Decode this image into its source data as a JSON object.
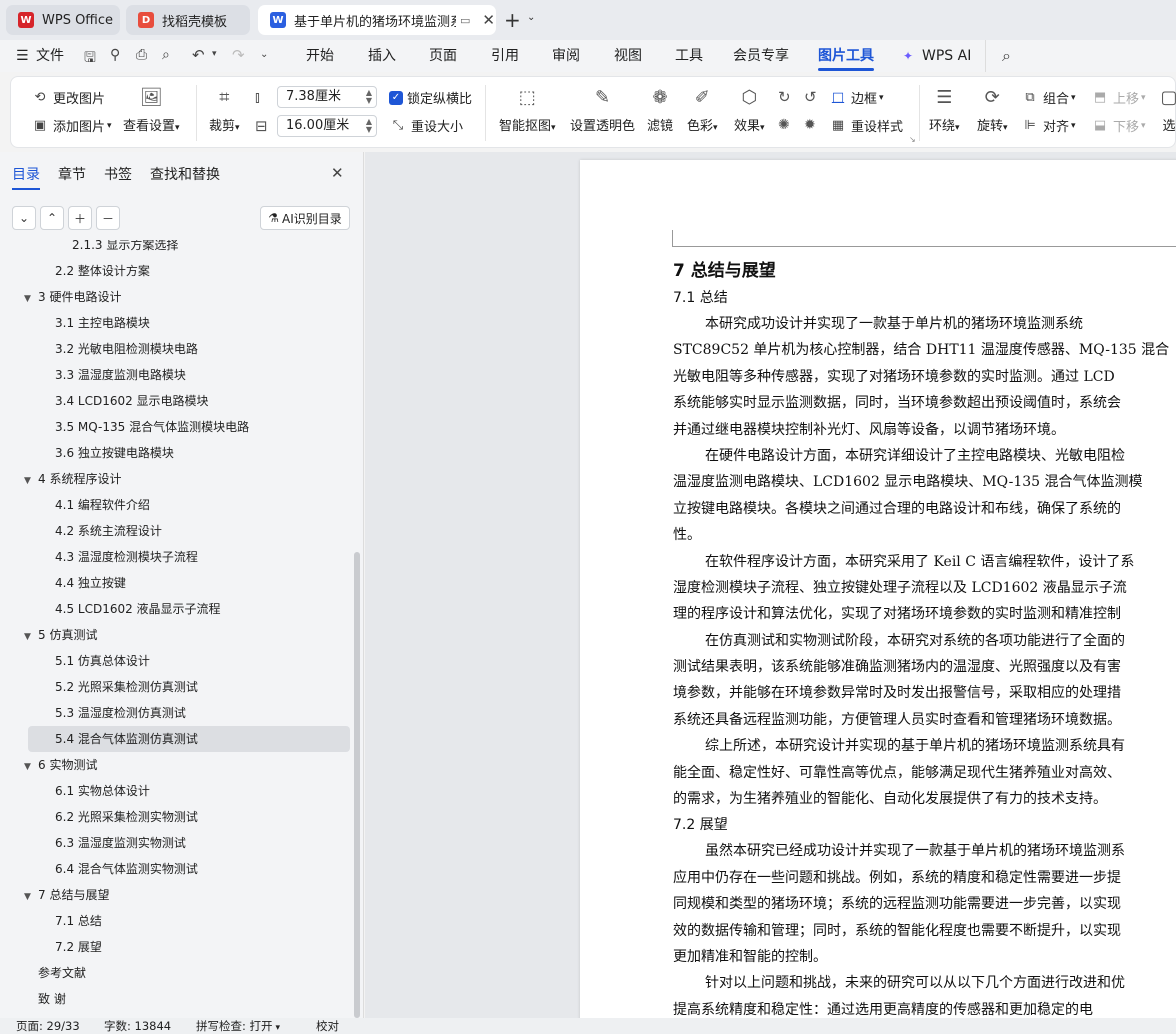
{
  "tabs": [
    {
      "label": "WPS Office",
      "icon": "wps-logo-icon",
      "color": "#d6242a"
    },
    {
      "label": "找稻壳模板",
      "icon": "docer-icon",
      "color": "#e84d3d"
    },
    {
      "label": "基于单片机的猪场环境监测系",
      "icon": "word-doc-icon",
      "color": "#2b5fe0"
    }
  ],
  "menu": {
    "file": "文件",
    "items": [
      "开始",
      "插入",
      "页面",
      "引用",
      "审阅",
      "视图",
      "工具",
      "会员专享",
      "图片工具",
      "WPS AI"
    ],
    "active": "图片工具"
  },
  "ribbon": {
    "change_image": "更改图片",
    "add_image": "添加图片",
    "view_settings": "查看设置",
    "crop": "裁剪",
    "width": "7.38厘米",
    "height": "16.00厘米",
    "lock_ratio": "锁定纵横比",
    "reset_size": "重设大小",
    "smart_cutout": "智能抠图",
    "set_transparent": "设置透明色",
    "filter": "滤镜",
    "color": "色彩",
    "effect": "效果",
    "border": "边框",
    "reset_style": "重设样式",
    "wrap": "环绕",
    "rotate": "旋转",
    "group": "组合",
    "align": "对齐",
    "bring_forward": "上移",
    "send_backward": "下移",
    "select": "选"
  },
  "sidebar": {
    "tabs": [
      "目录",
      "章节",
      "书签",
      "查找和替换"
    ],
    "ai_button": "AI识别目录",
    "toc": [
      {
        "label": "2.1.3  显示方案选择",
        "level": 3
      },
      {
        "label": "2.2  整体设计方案",
        "level": 2
      },
      {
        "label": "3    硬件电路设计",
        "level": 1,
        "expanded": true
      },
      {
        "label": "3.1  主控电路模块",
        "level": 2
      },
      {
        "label": "3.2  光敏电阻检测模块电路",
        "level": 2
      },
      {
        "label": "3.3  温湿度监测电路模块",
        "level": 2
      },
      {
        "label": "3.4 LCD1602 显示电路模块",
        "level": 2
      },
      {
        "label": "3.5 MQ-135 混合气体监测模块电路",
        "level": 2
      },
      {
        "label": "3.6  独立按键电路模块",
        "level": 2
      },
      {
        "label": "4    系统程序设计",
        "level": 1,
        "expanded": true
      },
      {
        "label": "4.1  编程软件介绍",
        "level": 2
      },
      {
        "label": "4.2  系统主流程设计",
        "level": 2
      },
      {
        "label": "4.3  温湿度检测模块子流程",
        "level": 2
      },
      {
        "label": "4.4  独立按键",
        "level": 2
      },
      {
        "label": "4.5 LCD1602 液晶显示子流程",
        "level": 2
      },
      {
        "label": "5    仿真测试",
        "level": 1,
        "expanded": true
      },
      {
        "label": "5.1  仿真总体设计",
        "level": 2
      },
      {
        "label": "5.2  光照采集检测仿真测试",
        "level": 2
      },
      {
        "label": "5.3  温湿度检测仿真测试",
        "level": 2
      },
      {
        "label": "5.4  混合气体监测仿真测试",
        "level": 2,
        "selected": true
      },
      {
        "label": "6    实物测试",
        "level": 1,
        "expanded": true
      },
      {
        "label": "6.1  实物总体设计",
        "level": 2
      },
      {
        "label": "6.2  光照采集检测实物测试",
        "level": 2
      },
      {
        "label": "6.3  温湿度监测实物测试",
        "level": 2
      },
      {
        "label": "6.4  混合气体监测实物测试",
        "level": 2
      },
      {
        "label": "7    总结与展望",
        "level": 1,
        "expanded": true
      },
      {
        "label": "7.1  总结",
        "level": 2
      },
      {
        "label": "7.2  展望",
        "level": 2
      },
      {
        "label": "参考文献",
        "level": 1
      },
      {
        "label": "致    谢",
        "level": 1
      }
    ]
  },
  "document": {
    "chapter": "7    总结与展望",
    "s1": "7.1  总结",
    "p1": [
      "本研究成功设计并实现了一款基于单片机的猪场环境监测系统",
      "STC89C52 单片机为核心控制器，结合 DHT11 温湿度传感器、MQ-135 混合",
      "光敏电阻等多种传感器，实现了对猪场环境参数的实时监测。通过 LCD",
      "系统能够实时显示监测数据，同时，当环境参数超出预设阈值时，系统会",
      "并通过继电器模块控制补光灯、风扇等设备，以调节猪场环境。"
    ],
    "p2": [
      "在硬件电路设计方面，本研究详细设计了主控电路模块、光敏电阻检",
      "温湿度监测电路模块、LCD1602 显示电路模块、MQ-135 混合气体监测模",
      "立按键电路模块。各模块之间通过合理的电路设计和布线，确保了系统的",
      "性。"
    ],
    "p3": [
      "在软件程序设计方面，本研究采用了 Keil C 语言编程软件，设计了系",
      "湿度检测模块子流程、独立按键处理子流程以及 LCD1602 液晶显示子流",
      "理的程序设计和算法优化，实现了对猪场环境参数的实时监测和精准控制"
    ],
    "p4": [
      "在仿真测试和实物测试阶段，本研究对系统的各项功能进行了全面的",
      "测试结果表明，该系统能够准确监测猪场内的温湿度、光照强度以及有害",
      "境参数，并能够在环境参数异常时及时发出报警信号，采取相应的处理措",
      "系统还具备远程监测功能，方便管理人员实时查看和管理猪场环境数据。"
    ],
    "p5": [
      "综上所述，本研究设计并实现的基于单片机的猪场环境监测系统具有",
      "能全面、稳定性好、可靠性高等优点，能够满足现代生猪养殖业对高效、",
      "的需求，为生猪养殖业的智能化、自动化发展提供了有力的技术支持。"
    ],
    "s2": "7.2  展望",
    "p6": [
      "虽然本研究已经成功设计并实现了一款基于单片机的猪场环境监测系",
      "应用中仍存在一些问题和挑战。例如，系统的精度和稳定性需要进一步提",
      "同规模和类型的猪场环境；系统的远程监测功能需要进一步完善，以实现",
      "效的数据传输和管理；同时，系统的智能化程度也需要不断提升，以实现",
      "更加精准和智能的控制。"
    ],
    "p7": [
      "针对以上问题和挑战，未来的研究可以从以下几个方面进行改进和优",
      "提高系统精度和稳定性：通过选用更高精度的传感器和更加稳定的电"
    ]
  },
  "status": {
    "page": "页面: 29/33",
    "words": "字数: 13844",
    "spell": "拼写检查: 打开",
    "proof": "校对"
  }
}
